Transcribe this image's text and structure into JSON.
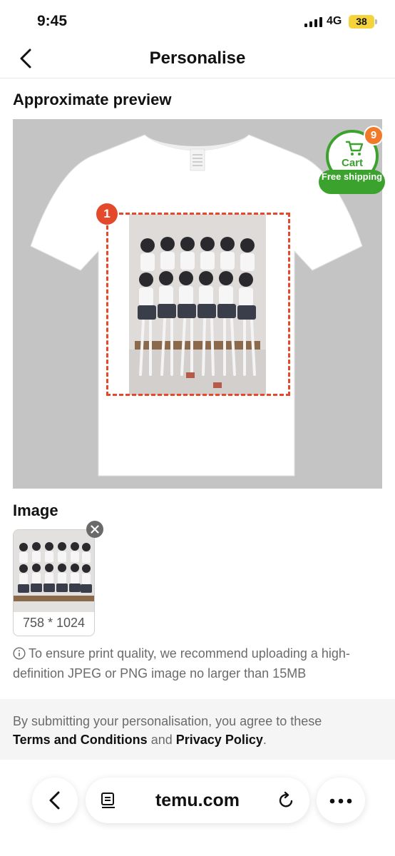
{
  "status_bar": {
    "time": "9:45",
    "network": "4G",
    "battery": "38"
  },
  "header": {
    "title": "Personalise"
  },
  "preview": {
    "title": "Approximate preview",
    "area_number": "1"
  },
  "cart": {
    "label": "Cart",
    "count": "9",
    "free_shipping": "Free shipping"
  },
  "image_section": {
    "title": "Image",
    "size": "758 * 1024"
  },
  "hint": "To ensure print quality, we recommend uploading a high-definition JPEG or PNG image no larger than 15MB",
  "terms": {
    "prefix": "By submitting your personalisation, you agree to these",
    "terms_link": "Terms and Conditions",
    "conjunction": "and",
    "privacy_link": "Privacy Policy",
    "suffix": "."
  },
  "browser": {
    "url": "temu.com"
  },
  "colors": {
    "accent": "#e5492b",
    "cart_green": "#3ba22d",
    "badge_orange": "#f07a2a"
  }
}
